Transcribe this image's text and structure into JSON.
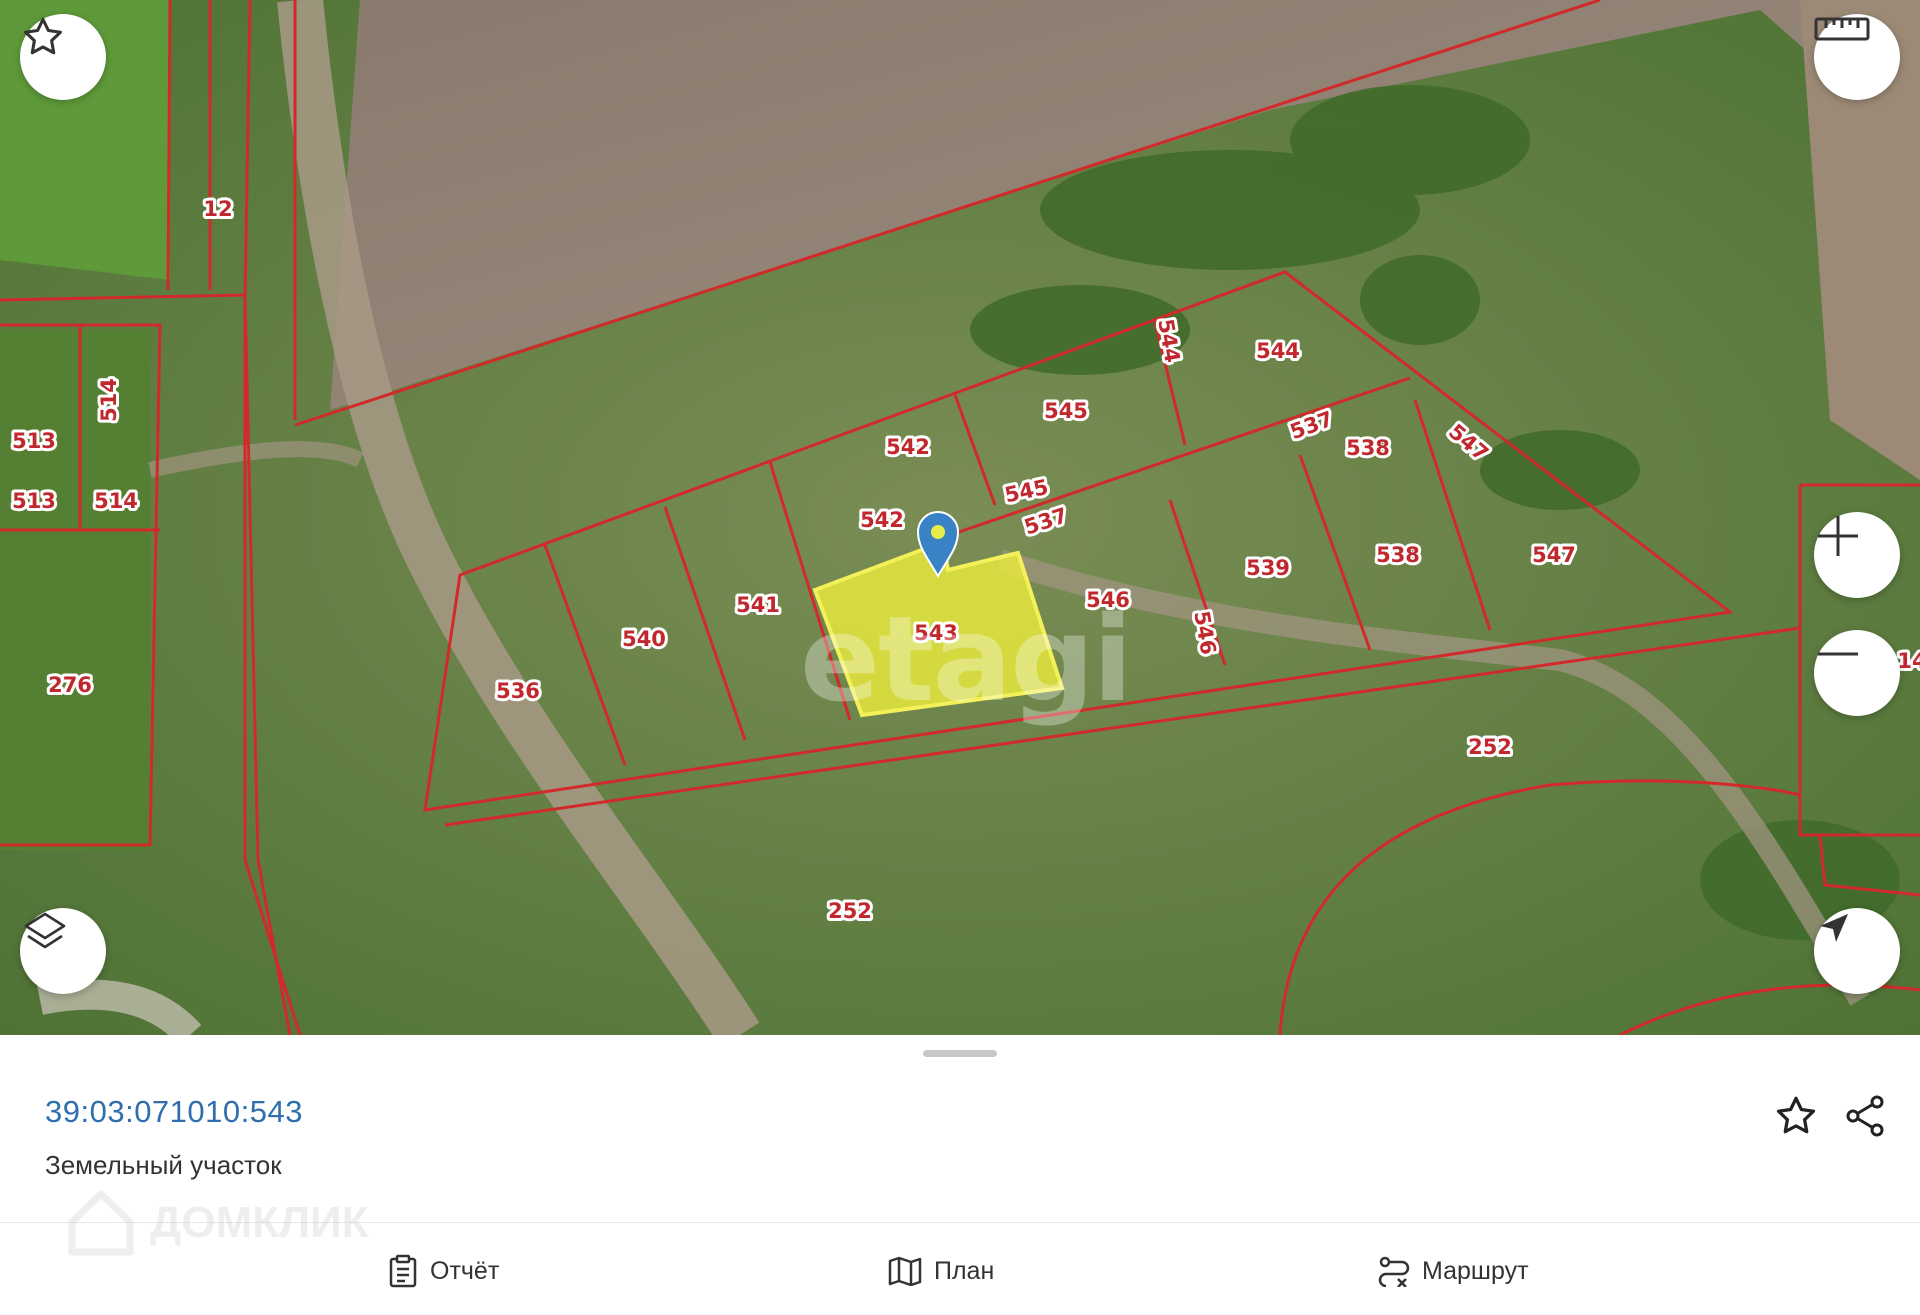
{
  "colors": {
    "boundary": "#d22a2a",
    "selected_fill": "#e9ec3c",
    "selected_stroke": "#f4f05a",
    "link": "#2f6fae",
    "pin": "#3a82c6"
  },
  "map": {
    "watermark": "etagi",
    "plot_labels": [
      "12",
      "513",
      "514",
      "513",
      "514",
      "276",
      "536",
      "540",
      "541",
      "542",
      "542",
      "543",
      "544",
      "544",
      "545",
      "545",
      "537",
      "537",
      "538",
      "538",
      "547",
      "547",
      "539",
      "546",
      "546",
      "252",
      "252",
      "14"
    ]
  },
  "map_controls": {
    "favorite_icon": "star-icon",
    "ruler_icon": "ruler-icon",
    "zoom_in_icon": "plus-icon",
    "zoom_out_icon": "minus-icon",
    "layers_icon": "layers-icon",
    "locate_icon": "navigation-arrow-icon"
  },
  "sheet": {
    "cadastral_number": "39:03:071010:543",
    "plot_type": "Земельный участок"
  },
  "footer_watermark": "ДОМКЛИК",
  "bottom_nav": {
    "report": "Отчёт",
    "plan": "План",
    "route": "Маршрут"
  }
}
